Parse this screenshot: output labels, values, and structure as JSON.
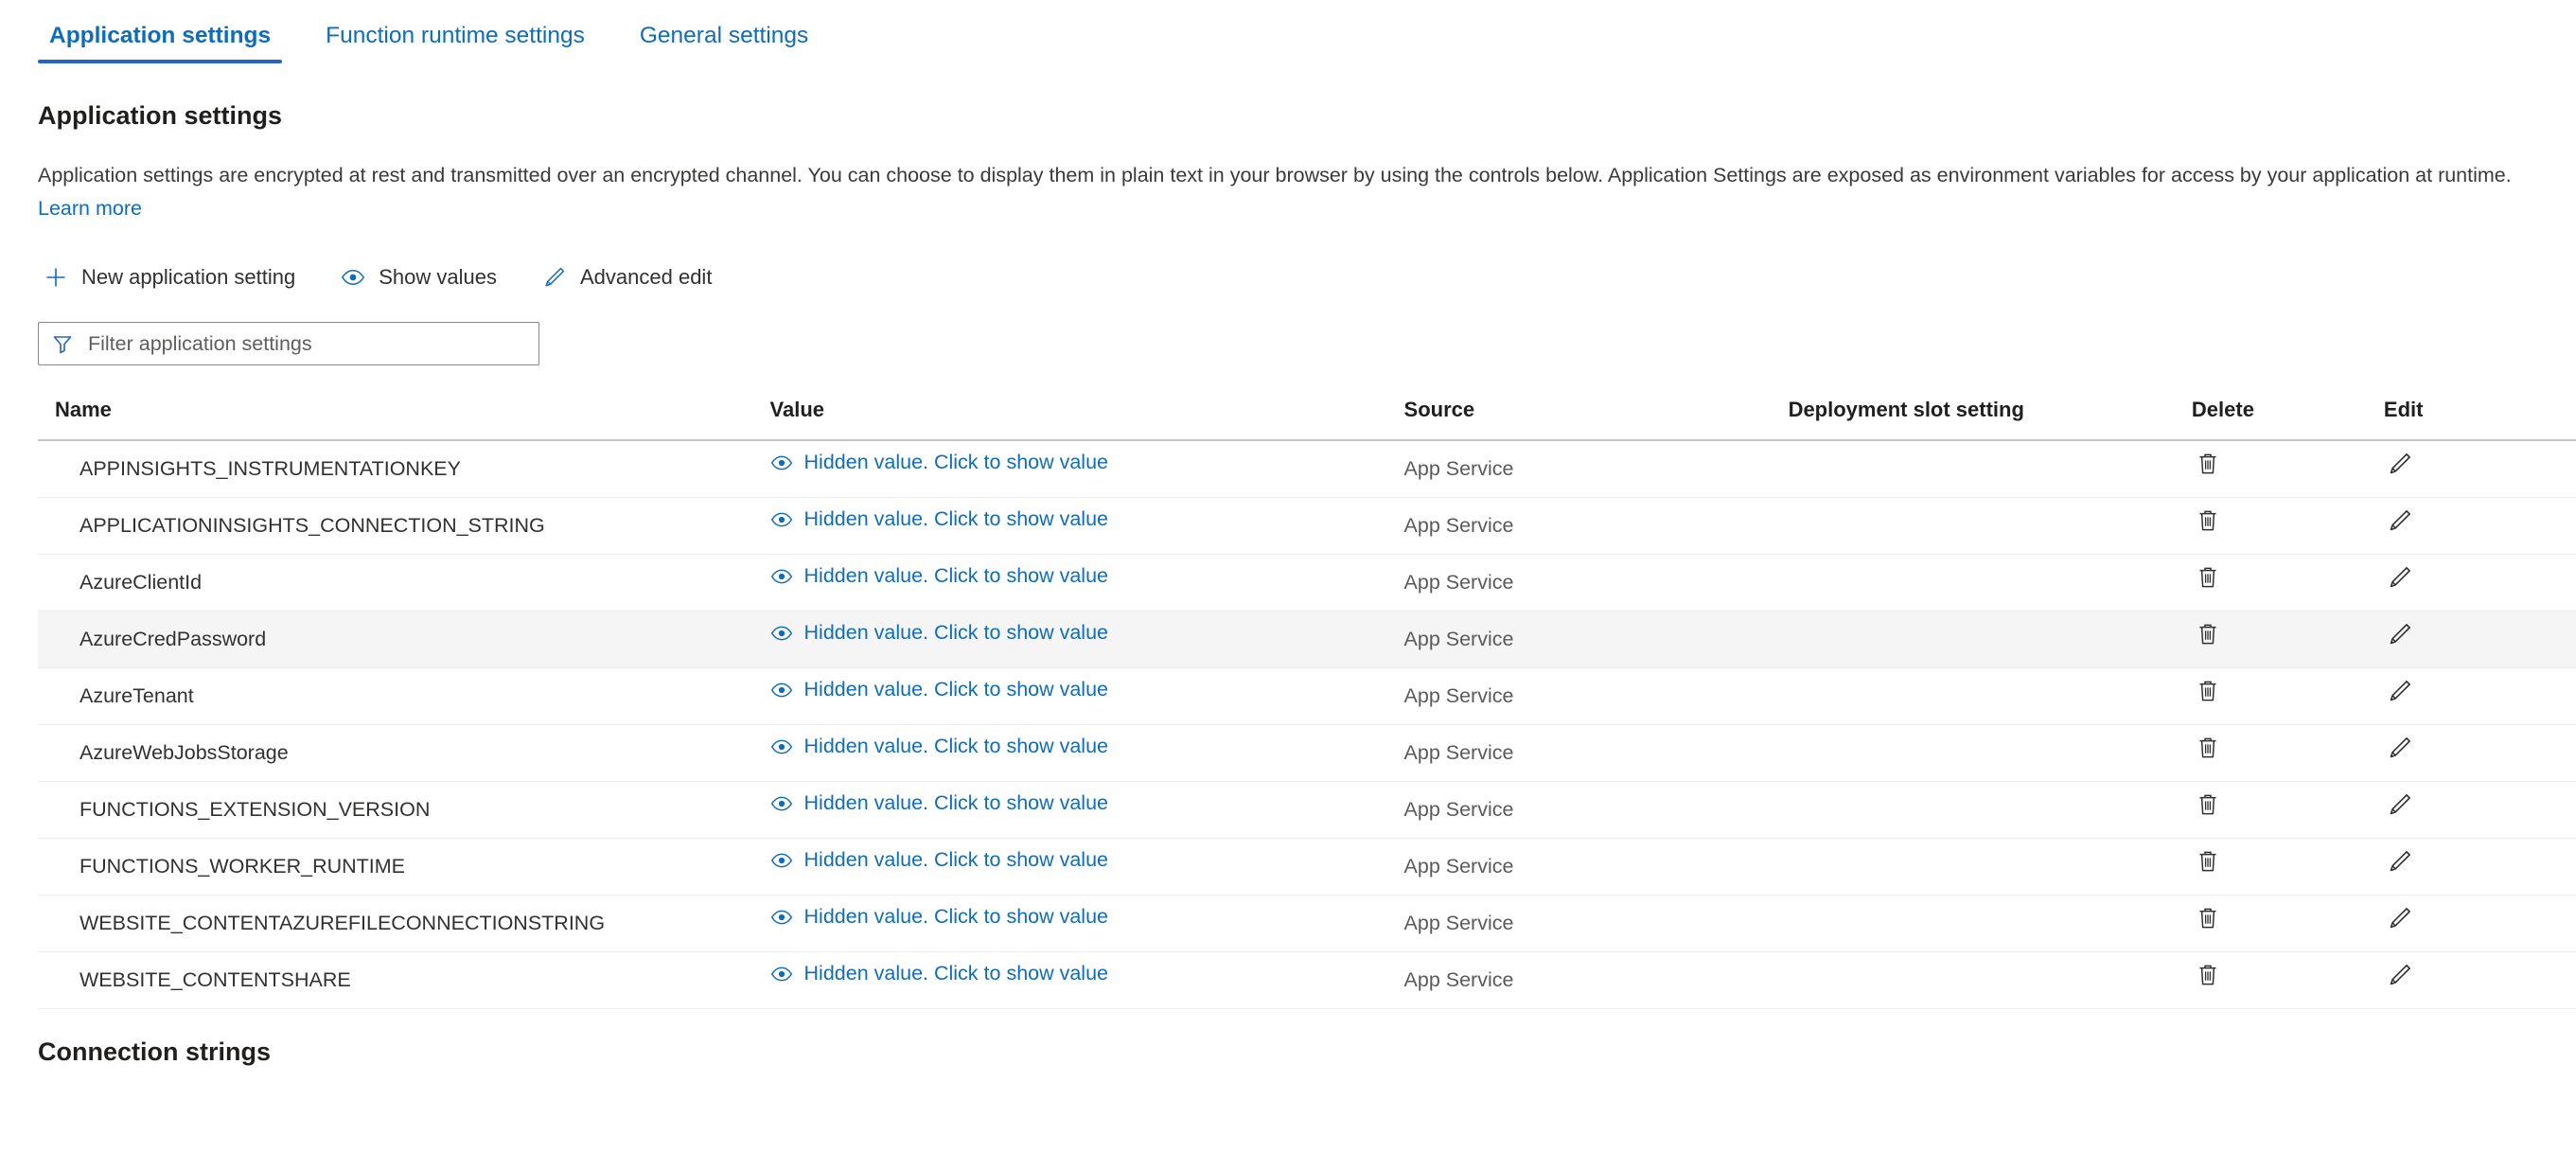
{
  "tabs": [
    {
      "label": "Application settings",
      "active": true
    },
    {
      "label": "Function runtime settings",
      "active": false
    },
    {
      "label": "General settings",
      "active": false
    }
  ],
  "page": {
    "heading": "Application settings",
    "description_part1": "Application settings are encrypted at rest and transmitted over an encrypted channel. You can choose to display them in plain text in your browser by using the controls below. Application Settings are exposed as environment variables for access by your application at runtime. ",
    "learn_more": "Learn more",
    "footer_heading": "Connection strings"
  },
  "toolbar": {
    "new_setting": "New application setting",
    "show_values": "Show values",
    "advanced_edit": "Advanced edit",
    "icons": {
      "new": "plus-icon",
      "show": "eye-icon",
      "advanced": "pencil-icon"
    }
  },
  "filter": {
    "placeholder": "Filter application settings",
    "value": "",
    "icon": "filter-icon"
  },
  "table": {
    "columns": [
      "Name",
      "Value",
      "Source",
      "Deployment slot setting",
      "Delete",
      "Edit"
    ],
    "value_link_text": "Hidden value. Click to show value",
    "rows": [
      {
        "name": "APPINSIGHTS_INSTRUMENTATIONKEY",
        "value": "Hidden value. Click to show value",
        "source": "App Service",
        "slot": "",
        "hovered": false
      },
      {
        "name": "APPLICATIONINSIGHTS_CONNECTION_STRING",
        "value": "Hidden value. Click to show value",
        "source": "App Service",
        "slot": "",
        "hovered": false
      },
      {
        "name": "AzureClientId",
        "value": "Hidden value. Click to show value",
        "source": "App Service",
        "slot": "",
        "hovered": false
      },
      {
        "name": "AzureCredPassword",
        "value": "Hidden value. Click to show value",
        "source": "App Service",
        "slot": "",
        "hovered": true
      },
      {
        "name": "AzureTenant",
        "value": "Hidden value. Click to show value",
        "source": "App Service",
        "slot": "",
        "hovered": false
      },
      {
        "name": "AzureWebJobsStorage",
        "value": "Hidden value. Click to show value",
        "source": "App Service",
        "slot": "",
        "hovered": false
      },
      {
        "name": "FUNCTIONS_EXTENSION_VERSION",
        "value": "Hidden value. Click to show value",
        "source": "App Service",
        "slot": "",
        "hovered": false
      },
      {
        "name": "FUNCTIONS_WORKER_RUNTIME",
        "value": "Hidden value. Click to show value",
        "source": "App Service",
        "slot": "",
        "hovered": false
      },
      {
        "name": "WEBSITE_CONTENTAZUREFILECONNECTIONSTRING",
        "value": "Hidden value. Click to show value",
        "source": "App Service",
        "slot": "",
        "hovered": false
      },
      {
        "name": "WEBSITE_CONTENTSHARE",
        "value": "Hidden value. Click to show value",
        "source": "App Service",
        "slot": "",
        "hovered": false
      }
    ]
  },
  "colors": {
    "accent": "#0f6cbd",
    "tab_underline": "#2563c9",
    "text": "#323130",
    "muted": "#5a5a5a",
    "row_hover": "#f5f5f5",
    "header_rule": "#c8c6c4"
  }
}
